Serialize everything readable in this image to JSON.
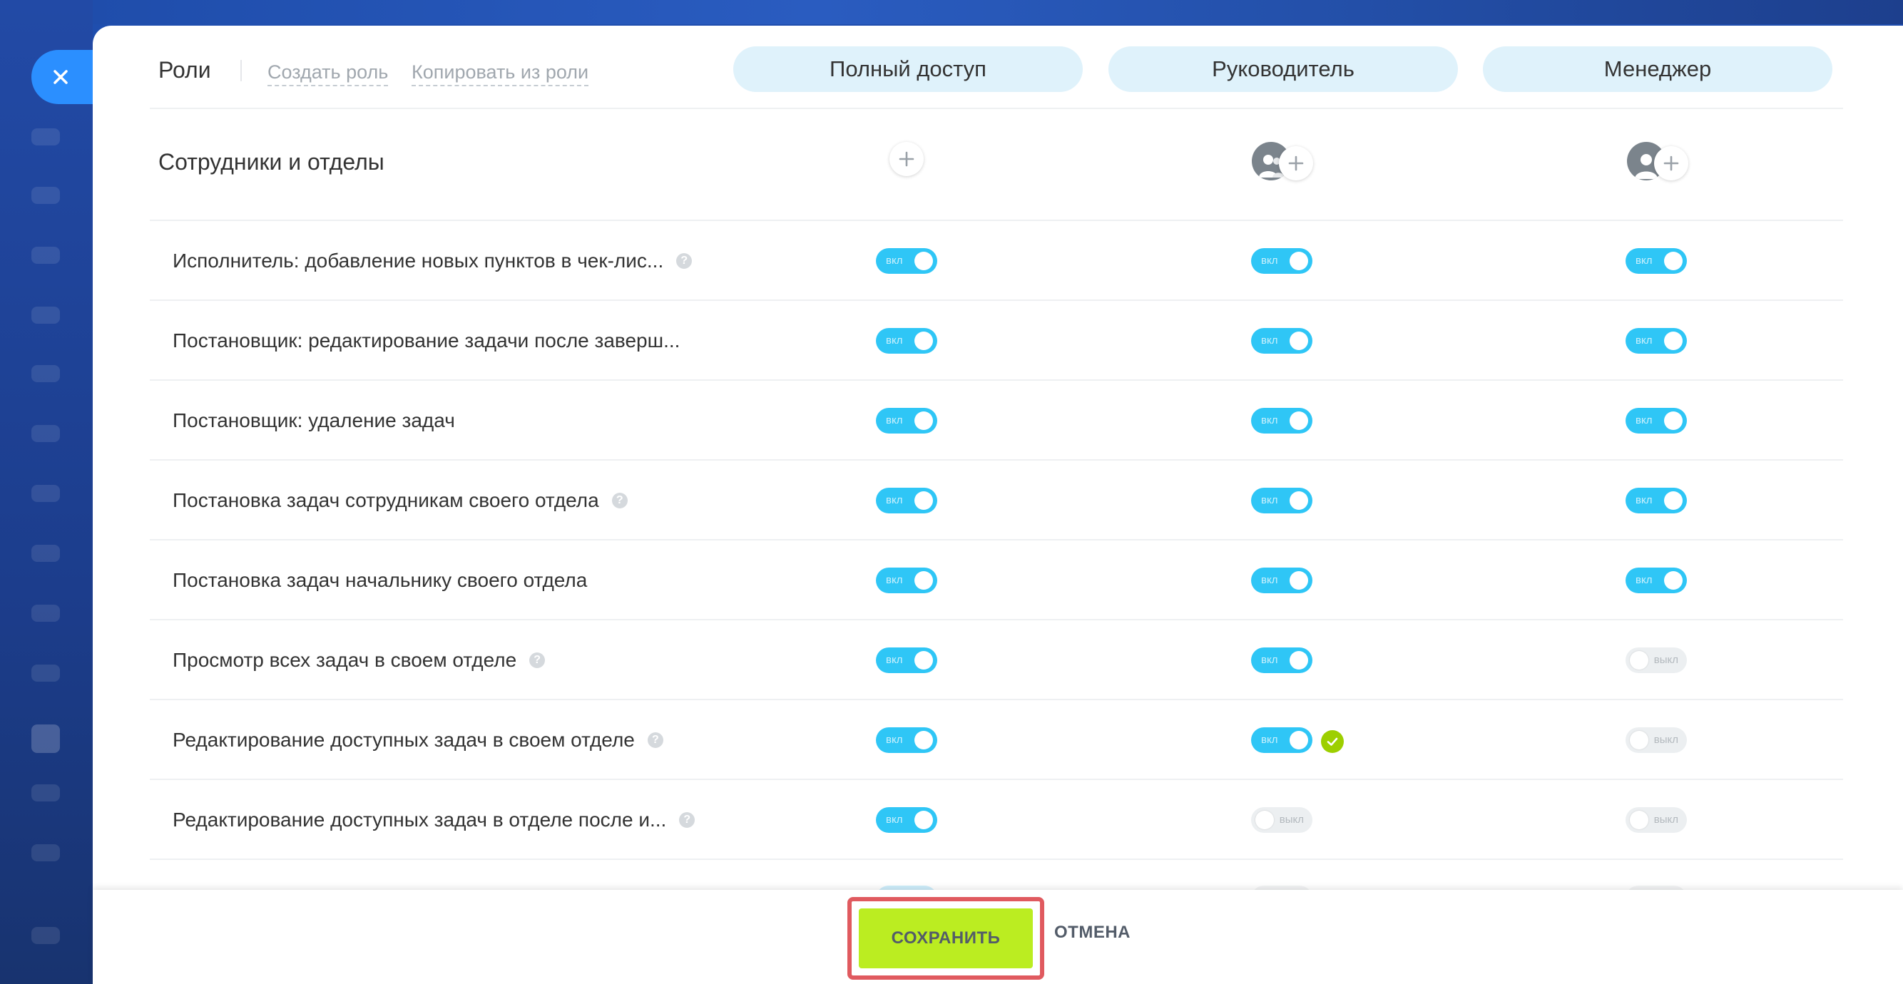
{
  "header": {
    "roles_title": "Роли",
    "create_role": "Создать роль",
    "copy_role": "Копировать из роли"
  },
  "roles": [
    {
      "label": "Полный доступ"
    },
    {
      "label": "Руководитель"
    },
    {
      "label": "Менеджер"
    }
  ],
  "staff_section": {
    "title": "Сотрудники и отделы",
    "add_symbol": "+"
  },
  "toggle_labels": {
    "on": "вкл",
    "off": "выкл"
  },
  "help_symbol": "?",
  "permissions": [
    {
      "label": "Исполнитель: добавление новых пунктов в чек-лис...",
      "help": true,
      "values": [
        "on",
        "on",
        "on"
      ]
    },
    {
      "label": "Постановщик: редактирование задачи после заверш...",
      "help": false,
      "values": [
        "on",
        "on",
        "on"
      ]
    },
    {
      "label": "Постановщик: удаление задач",
      "help": false,
      "values": [
        "on",
        "on",
        "on"
      ]
    },
    {
      "label": "Постановка задач сотрудникам своего отдела",
      "help": true,
      "values": [
        "on",
        "on",
        "on"
      ]
    },
    {
      "label": "Постановка задач начальнику своего отдела",
      "help": false,
      "values": [
        "on",
        "on",
        "on"
      ]
    },
    {
      "label": "Просмотр всех задач в своем отделе",
      "help": true,
      "values": [
        "on",
        "on",
        "off"
      ]
    },
    {
      "label": "Редактирование доступных задач в своем отделе",
      "help": true,
      "values": [
        "on",
        "on",
        "off"
      ],
      "check_col": 1
    },
    {
      "label": "Редактирование доступных задач в отделе после и...",
      "help": true,
      "values": [
        "on",
        "off",
        "off"
      ]
    }
  ],
  "footer": {
    "save_label": "СОХРАНИТЬ",
    "cancel_label": "ОТМЕНА"
  },
  "colors": {
    "toggle_on": "#2fc6f6",
    "toggle_off": "#eceff1",
    "role_pill": "#dff2fb",
    "save_button": "#bbed21",
    "highlight_frame": "#e05a5f",
    "close_button": "#2b8fff",
    "check_badge": "#9dcf00"
  },
  "icons": {
    "close": "close-icon",
    "add": "plus-icon",
    "user_group": "user-group-icon",
    "user": "user-icon",
    "help": "help-icon",
    "check": "check-icon"
  }
}
